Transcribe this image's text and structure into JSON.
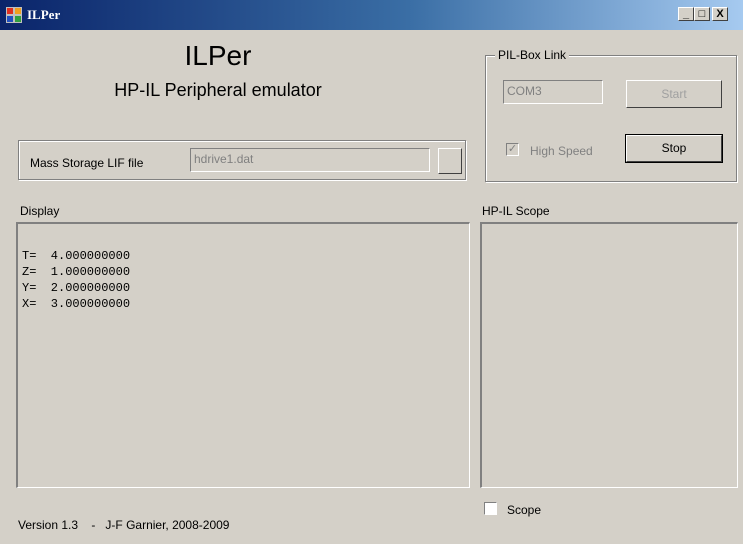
{
  "window": {
    "title": "ILPer",
    "icon": "app-icon",
    "minimize": "_",
    "maximize": "□",
    "close": "X"
  },
  "header": {
    "title": "ILPer",
    "subtitle": "HP-IL Peripheral emulator"
  },
  "mass_storage": {
    "label": "Mass Storage LIF file",
    "value": "hdrive1.dat"
  },
  "pil_box": {
    "legend": "PIL-Box Link",
    "port_value": "COM3",
    "start_label": "Start",
    "stop_label": "Stop",
    "high_speed_label": "High Speed",
    "high_speed_checked": true
  },
  "display": {
    "label": "Display",
    "lines": [
      "T=  4.000000000",
      "Z=  1.000000000",
      "Y=  2.000000000",
      "X=  3.000000000"
    ]
  },
  "scope": {
    "label": "HP-IL Scope",
    "checkbox_label": "Scope",
    "checked": false
  },
  "footer": {
    "version": "Version 1.3",
    "author": "J-F Garnier, 2008-2009"
  }
}
